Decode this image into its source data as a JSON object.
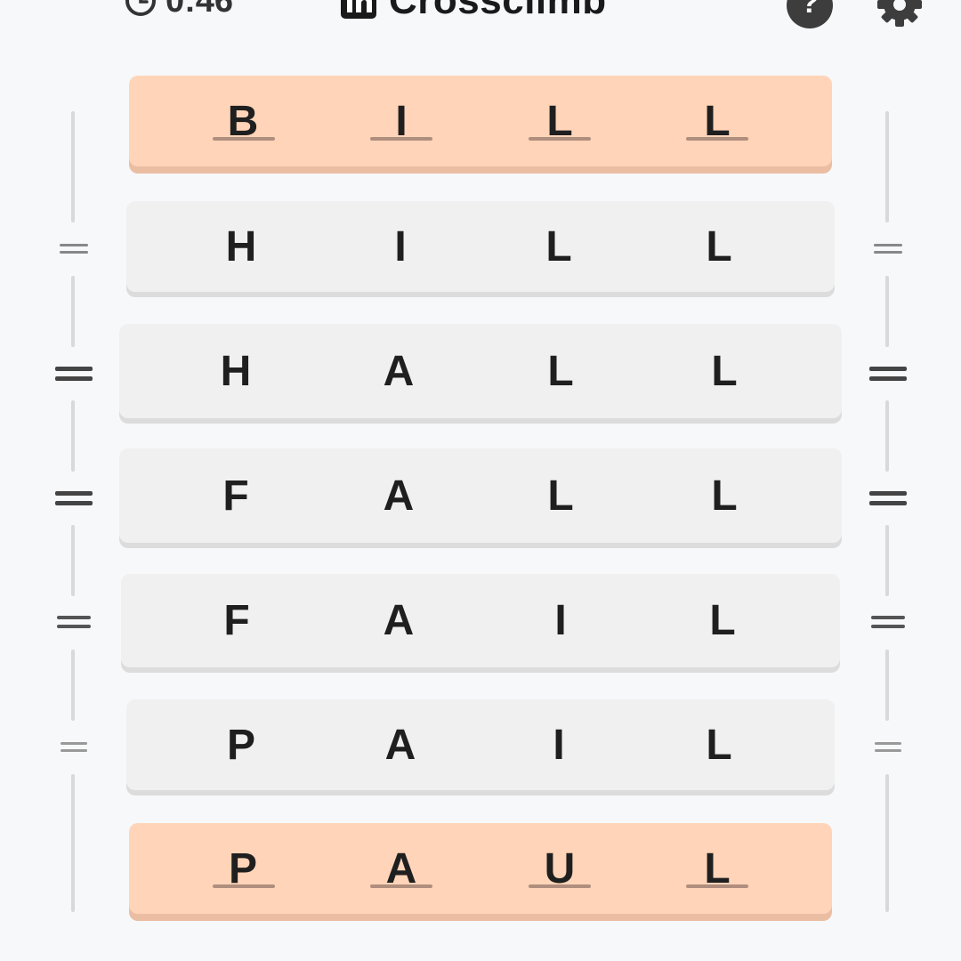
{
  "header": {
    "timer": "0:46",
    "title": "Crossclimb",
    "help_label": "?"
  },
  "rows": [
    {
      "letters": [
        "B",
        "I",
        "L",
        "L"
      ],
      "locked": true
    },
    {
      "letters": [
        "H",
        "I",
        "L",
        "L"
      ],
      "locked": false
    },
    {
      "letters": [
        "H",
        "A",
        "L",
        "L"
      ],
      "locked": false
    },
    {
      "letters": [
        "F",
        "A",
        "L",
        "L"
      ],
      "locked": false
    },
    {
      "letters": [
        "F",
        "A",
        "I",
        "L"
      ],
      "locked": false
    },
    {
      "letters": [
        "P",
        "A",
        "I",
        "L"
      ],
      "locked": false
    },
    {
      "letters": [
        "P",
        "A",
        "U",
        "L"
      ],
      "locked": true
    }
  ],
  "colors": {
    "locked_row": "#ffd4b8",
    "unlocked_row": "#f0f0f0",
    "background": "#f7f8fa"
  }
}
